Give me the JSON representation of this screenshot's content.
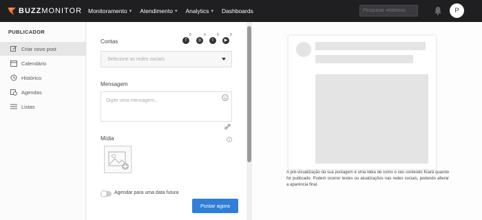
{
  "brand": {
    "name_bold": "BUZZ",
    "name_thin": "MONITOR"
  },
  "nav": {
    "items": [
      {
        "label": "Monitoramento",
        "chevron": "▾"
      },
      {
        "label": "Atendimento",
        "chevron": "▾"
      },
      {
        "label": "Analytics",
        "chevron": "▾"
      },
      {
        "label": "Dashboards",
        "chevron": ""
      }
    ],
    "search_placeholder": "Pesquisar relatórios",
    "avatar_initial": "P"
  },
  "sidebar": {
    "title": "PUBLICADOR",
    "items": [
      {
        "label": "Criar novo post",
        "icon": "edit-icon",
        "active": true
      },
      {
        "label": "Calendário",
        "icon": "calendar-icon",
        "active": false
      },
      {
        "label": "Histórico",
        "icon": "history-icon",
        "active": false
      },
      {
        "label": "Agendas",
        "icon": "schedule-icon",
        "active": false
      },
      {
        "label": "Listas",
        "icon": "list-icon",
        "active": false
      }
    ]
  },
  "form": {
    "contas_label": "Contas",
    "networks": [
      {
        "name": "facebook",
        "glyph": "f",
        "count": "0"
      },
      {
        "name": "instagram",
        "glyph": "◎",
        "count": "0"
      },
      {
        "name": "twitter",
        "glyph": "t",
        "count": "0"
      },
      {
        "name": "youtube",
        "glyph": "▶",
        "count": "0"
      }
    ],
    "select_placeholder": "Selecione as redes sociais",
    "mensagem_label": "Mensagem",
    "message_placeholder": "Digite uma mensagem...",
    "midia_label": "Mídia",
    "schedule_label": "Agendar para uma data futura",
    "post_button": "Postar agora"
  },
  "preview": {
    "note": "A pré-visualização da sua postagem é uma ideia de como o seu conteúdo ficará quando for publicado. Podem ocorrer testes ou atualizações nas redes sociais, podendo alterar a aparência final."
  },
  "colors": {
    "topbar": "#1f1f22",
    "accent": "#2f7fd8",
    "logo": "#e8742a"
  }
}
